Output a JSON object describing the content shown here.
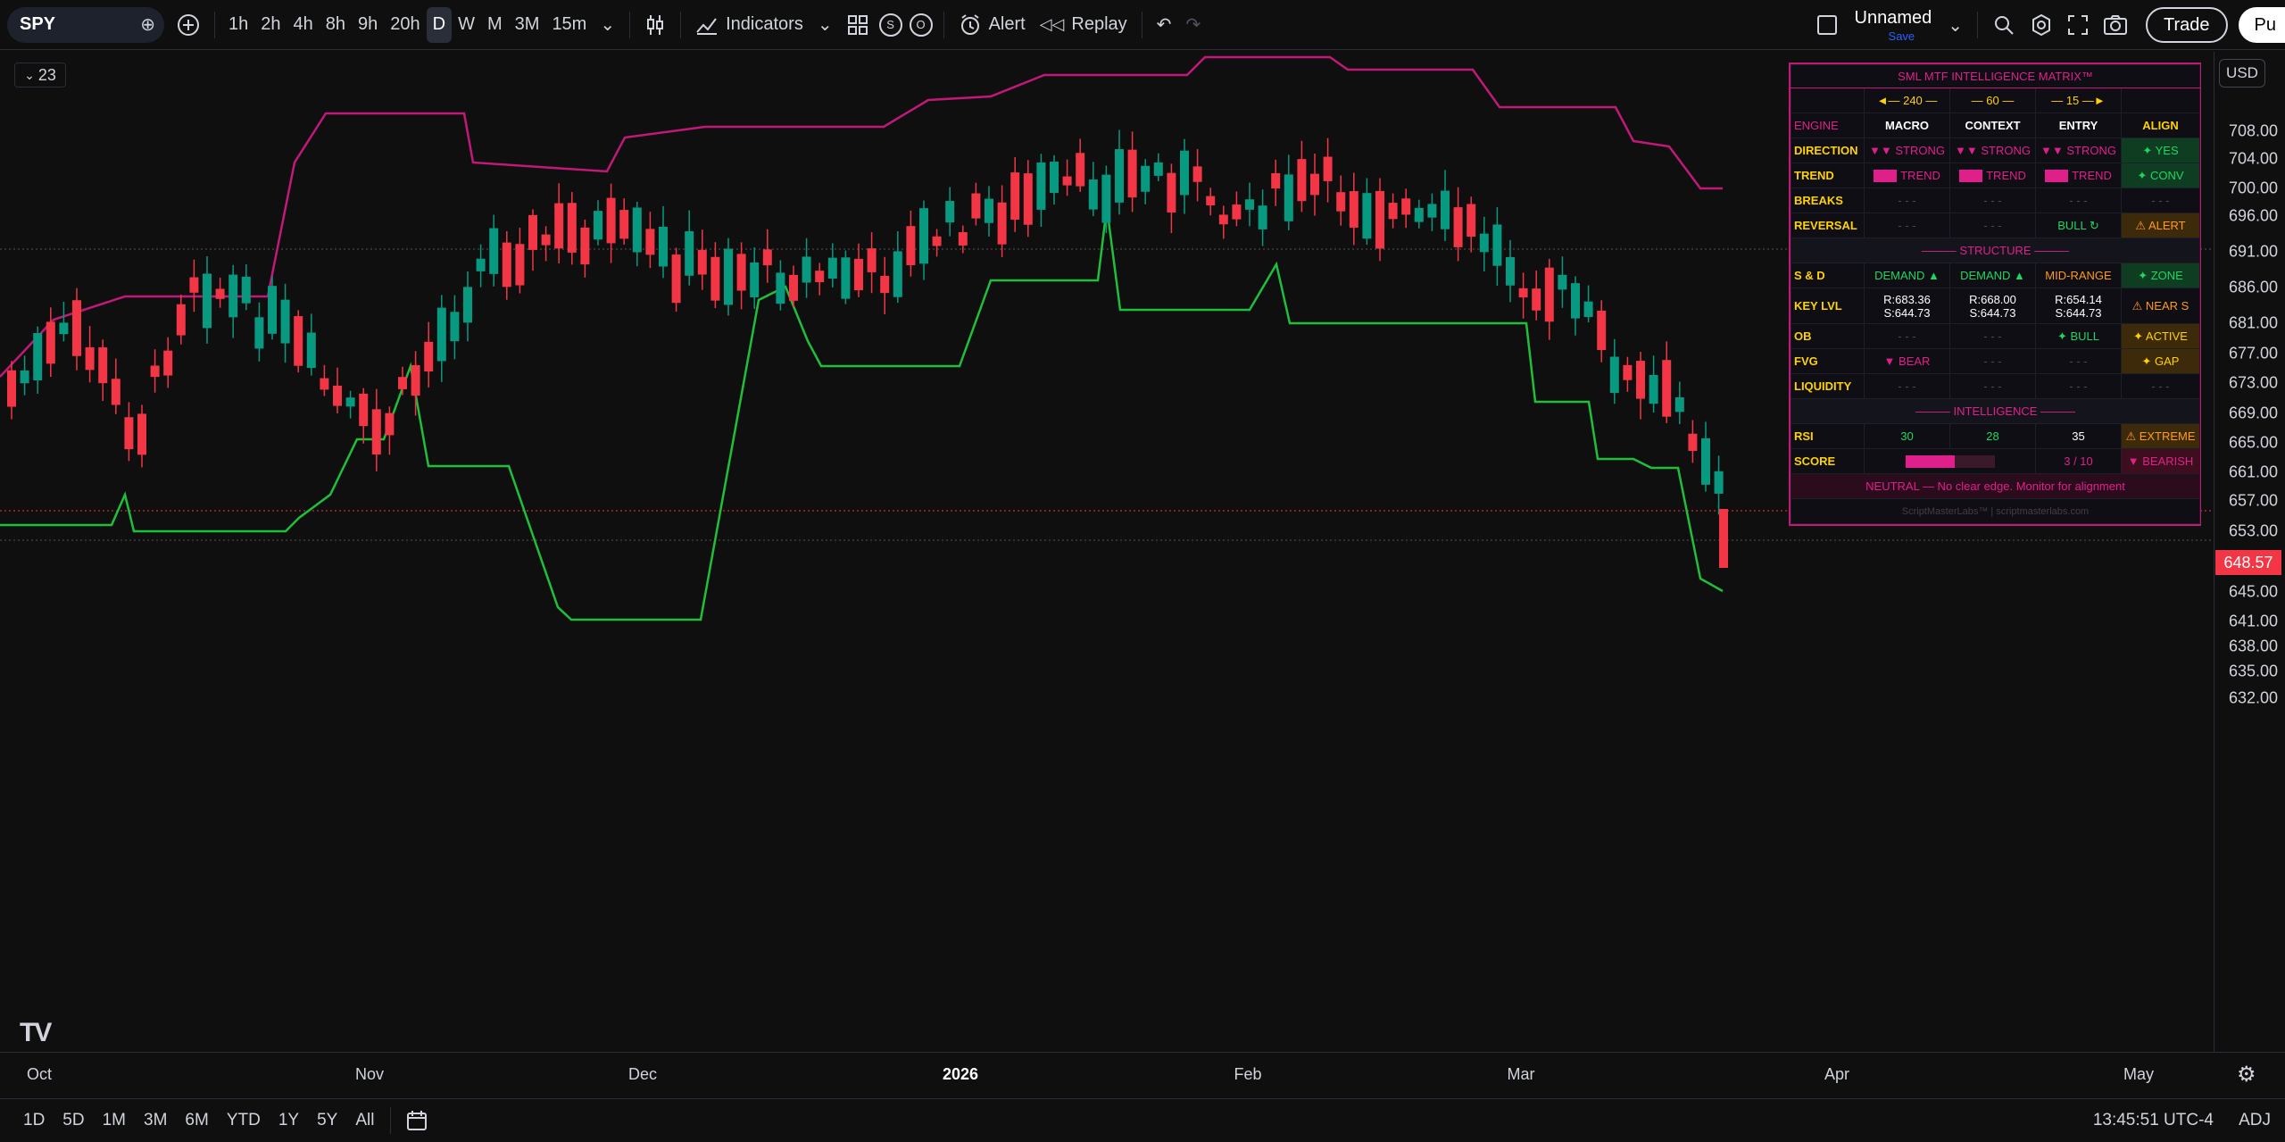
{
  "toolbar": {
    "symbol": "SPY",
    "timeframes": [
      "1h",
      "2h",
      "4h",
      "8h",
      "9h",
      "20h",
      "D",
      "W",
      "M",
      "3M",
      "15m"
    ],
    "active_timeframe": "D",
    "indicators_label": "Indicators",
    "badge_s": "S",
    "badge_o": "O",
    "alert_label": "Alert",
    "replay_label": "Replay",
    "layout_name": "Unnamed",
    "save_label": "Save",
    "trade_label": "Trade",
    "publish_label": "Pu"
  },
  "chart": {
    "collapse_count": "23",
    "currency": "USD",
    "last_price": "648.57",
    "price_ticks": [
      "708.00",
      "704.00",
      "700.00",
      "696.00",
      "691.00",
      "686.00",
      "681.00",
      "677.00",
      "673.00",
      "669.00",
      "665.00",
      "661.00",
      "657.00",
      "653.00",
      "648.57",
      "645.00",
      "641.00",
      "638.00",
      "635.00",
      "632.00"
    ],
    "time_ticks": [
      {
        "label": "Oct",
        "bold": false
      },
      {
        "label": "Nov",
        "bold": false
      },
      {
        "label": "Dec",
        "bold": false
      },
      {
        "label": "2026",
        "bold": true
      },
      {
        "label": "Feb",
        "bold": false
      },
      {
        "label": "Mar",
        "bold": false
      },
      {
        "label": "Apr",
        "bold": false
      },
      {
        "label": "May",
        "bold": false
      }
    ],
    "colors": {
      "up": "#089981",
      "down": "#f23645",
      "upper_band": "#c2187a",
      "lower_band": "#1fbf3a"
    }
  },
  "matrix": {
    "title": "SML MTF INTELLIGENCE MATRIX™",
    "tf_row": [
      "",
      "◄— 240 —",
      "— 60 —",
      "— 15 —►",
      ""
    ],
    "header": [
      "ENGINE",
      "MACRO",
      "CONTEXT",
      "ENTRY",
      "ALIGN"
    ],
    "rows": [
      {
        "label": "DIRECTION",
        "cells": [
          "▼▼ STRONG",
          "▼▼ STRONG",
          "▼▼ STRONG"
        ],
        "align": "✦ YES"
      },
      {
        "label": "TREND",
        "cells": [
          "TREND",
          "TREND",
          "TREND"
        ],
        "align": "✦ CONV"
      },
      {
        "label": "BREAKS",
        "cells": [
          "- - -",
          "- - -",
          "- - -"
        ],
        "align": "- - -"
      },
      {
        "label": "REVERSAL",
        "cells": [
          "- - -",
          "- - -",
          "BULL ↻"
        ],
        "align": "⚠ ALERT"
      }
    ],
    "structure_label": "——— STRUCTURE ———",
    "structure_rows": [
      {
        "label": "S & D",
        "cells": [
          "DEMAND ▲",
          "DEMAND ▲",
          "MID-RANGE"
        ],
        "align": "✦ ZONE"
      },
      {
        "label": "KEY LVL",
        "cells": [
          [
            "R:683.36",
            "S:644.73"
          ],
          [
            "R:668.00",
            "S:644.73"
          ],
          [
            "R:654.14",
            "S:644.73"
          ]
        ],
        "align": "⚠ NEAR S"
      },
      {
        "label": "OB",
        "cells": [
          "- - -",
          "- - -",
          "✦ BULL"
        ],
        "align": "✦ ACTIVE"
      },
      {
        "label": "FVG",
        "cells": [
          "▼ BEAR",
          "- - -",
          "- - -"
        ],
        "align": "✦ GAP"
      },
      {
        "label": "LIQUIDITY",
        "cells": [
          "- - -",
          "- - -",
          "- - -"
        ],
        "align": "- - -"
      }
    ],
    "intelligence_label": "——— INTELLIGENCE ———",
    "rsi": {
      "label": "RSI",
      "values": [
        "30",
        "28",
        "35"
      ],
      "align": "⚠ EXTREME"
    },
    "score": {
      "label": "SCORE",
      "value": "3 / 10",
      "align": "▼ BEARISH"
    },
    "footer": "NEUTRAL — No clear edge. Monitor for alignment",
    "copyright": "ScriptMasterLabs™ | scriptmasterlabs.com"
  },
  "bottom": {
    "ranges": [
      "1D",
      "5D",
      "1M",
      "3M",
      "6M",
      "YTD",
      "1Y",
      "5Y",
      "All"
    ],
    "clock": "13:45:51 UTC-4",
    "adj": "ADJ"
  }
}
